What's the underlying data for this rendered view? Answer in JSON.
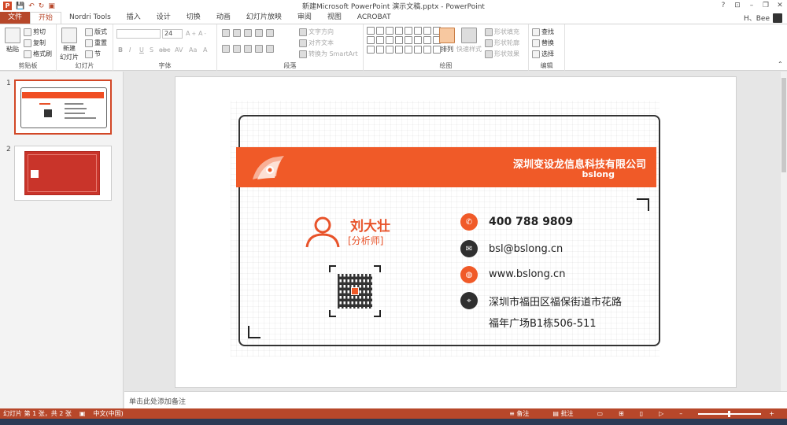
{
  "window": {
    "title": "新建Microsoft PowerPoint 演示文稿.pptx - PowerPoint",
    "app_logo": "P",
    "controls": {
      "help": "?",
      "ribbon_opts": "⊡",
      "minimize": "–",
      "restore": "❐",
      "close": "✕"
    }
  },
  "tabs": [
    {
      "label": "文件"
    },
    {
      "label": "开始"
    },
    {
      "label": "Nordri Tools"
    },
    {
      "label": "插入"
    },
    {
      "label": "设计"
    },
    {
      "label": "切换"
    },
    {
      "label": "动画"
    },
    {
      "label": "幻灯片放映"
    },
    {
      "label": "审阅"
    },
    {
      "label": "视图"
    },
    {
      "label": "ACROBAT"
    }
  ],
  "user": {
    "name": "H、Bee"
  },
  "ribbon": {
    "clipboard": {
      "label": "剪贴板",
      "paste": "粘贴",
      "cut": "剪切",
      "copy": "复制",
      "format_painter": "格式刷"
    },
    "slides": {
      "label": "幻灯片",
      "new_slide": "新建",
      "new_slide2": "幻灯片",
      "layout": "版式",
      "reset": "重置",
      "section": "节"
    },
    "font": {
      "label": "字体",
      "size": "24",
      "bold": "B",
      "italic": "I",
      "underline": "U",
      "strike": "S",
      "abc": "abc",
      "av": "AV",
      "aa": "Aa",
      "a_color": "A"
    },
    "paragraph": {
      "label": "段落",
      "text_direction": "文字方向",
      "align_text": "对齐文本",
      "smartart": "转换为 SmartArt"
    },
    "drawing": {
      "label": "绘图",
      "arrange": "排列",
      "quick_styles": "快速样式",
      "shape_fill": "形状填充",
      "shape_outline": "形状轮廓",
      "shape_effects": "形状效果"
    },
    "editing": {
      "label": "编辑",
      "find": "查找",
      "replace": "替换",
      "select": "选择"
    }
  },
  "thumbnails": [
    {
      "num": "1"
    },
    {
      "num": "2"
    }
  ],
  "slide": {
    "company": "深圳变设龙信息科技有限公司",
    "company_sub": "bslong",
    "name": "刘大壮",
    "role": "[分析师]",
    "phone": "400 788 9809",
    "email": "bsl@bslong.cn",
    "website": "www.bslong.cn",
    "address_line1": "深圳市福田区福保街道市花路",
    "address_line2": "福年广场B1栋506-511"
  },
  "notes": {
    "placeholder": "单击此处添加备注"
  },
  "status": {
    "slide_info": "幻灯片 第 1 张，共 2 张",
    "language": "中文(中国)",
    "notes_btn": "备注",
    "comments_btn": "批注"
  },
  "colors": {
    "accent": "#b7472a",
    "band": "#f05a28",
    "name": "#e8532a"
  }
}
